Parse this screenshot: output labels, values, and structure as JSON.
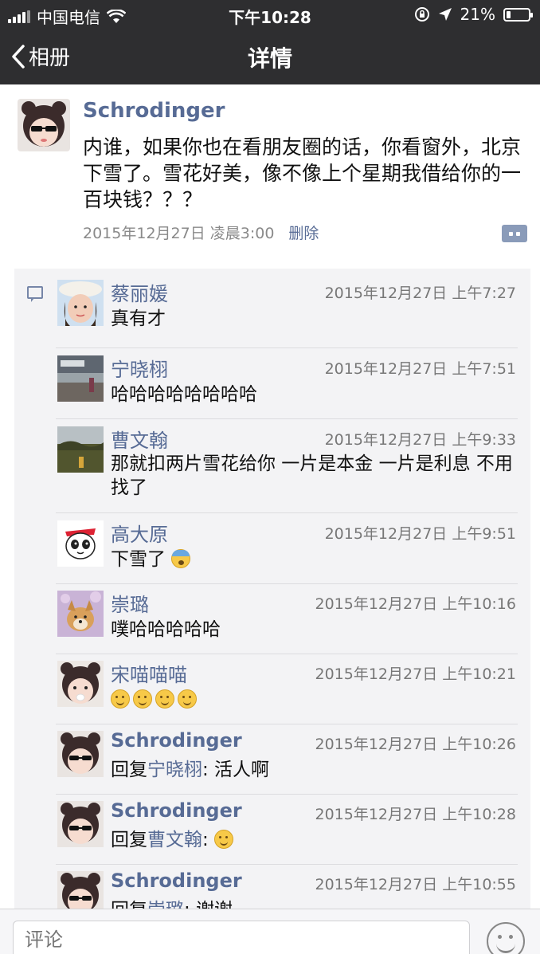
{
  "status": {
    "carrier": "中国电信",
    "time": "下午10:28",
    "battery": "21%",
    "battery_level": 0.21
  },
  "nav": {
    "back_label": "相册",
    "title": "详情"
  },
  "post": {
    "author": "Schrodinger",
    "text": "内谁，如果你也在看朋友圈的话，你看窗外，北京下雪了。雪花好美，像不像上个星期我借给你的一百块钱？？？",
    "time": "2015年12月27日 凌晨3:00",
    "delete_label": "删除"
  },
  "comments": [
    {
      "name": "蔡丽媛",
      "time": "2015年12月27日 上午7:27",
      "text": "真有才",
      "avatar": "girl-hat"
    },
    {
      "name": "宁晓栩",
      "time": "2015年12月27日 上午7:51",
      "text": "哈哈哈哈哈哈哈哈",
      "avatar": "city"
    },
    {
      "name": "曹文翰",
      "time": "2015年12月27日 上午9:33",
      "text": "那就扣两片雪花给你 一片是本金 一片是利息 不用找了",
      "avatar": "landscape"
    },
    {
      "name": "高大原",
      "time": "2015年12月27日 上午9:51",
      "text": "下雪了",
      "emoji": "fearful-face",
      "avatar": "panda"
    },
    {
      "name": "崇璐",
      "time": "2015年12月27日 上午10:16",
      "text": "噗哈哈哈哈哈",
      "avatar": "dog"
    },
    {
      "name": "宋喵喵喵",
      "time": "2015年12月27日 上午10:21",
      "text": "",
      "emojis": [
        "smile-face",
        "smile-face",
        "smile-face",
        "smile-face"
      ],
      "avatar": "bun-girl"
    },
    {
      "name": "Schrodinger",
      "time": "2015年12月27日 上午10:26",
      "reply_prefix": "回复",
      "reply_to": "宁晓栩",
      "text": ": 活人啊",
      "avatar": "sunglasses-girl"
    },
    {
      "name": "Schrodinger",
      "time": "2015年12月27日 上午10:28",
      "reply_prefix": "回复",
      "reply_to": "曹文翰",
      "text": ": ",
      "emoji": "smirk-face",
      "avatar": "sunglasses-girl"
    },
    {
      "name": "Schrodinger",
      "time": "2015年12月27日 上午10:55",
      "reply_prefix": "回复",
      "reply_to": "崇璐",
      "text": ": 谢谢",
      "avatar": "sunglasses-girl"
    }
  ],
  "input": {
    "placeholder": "评论"
  },
  "colors": {
    "bar": "#2e2e30",
    "link": "#576b95",
    "comment_bg": "#f3f3f5"
  }
}
